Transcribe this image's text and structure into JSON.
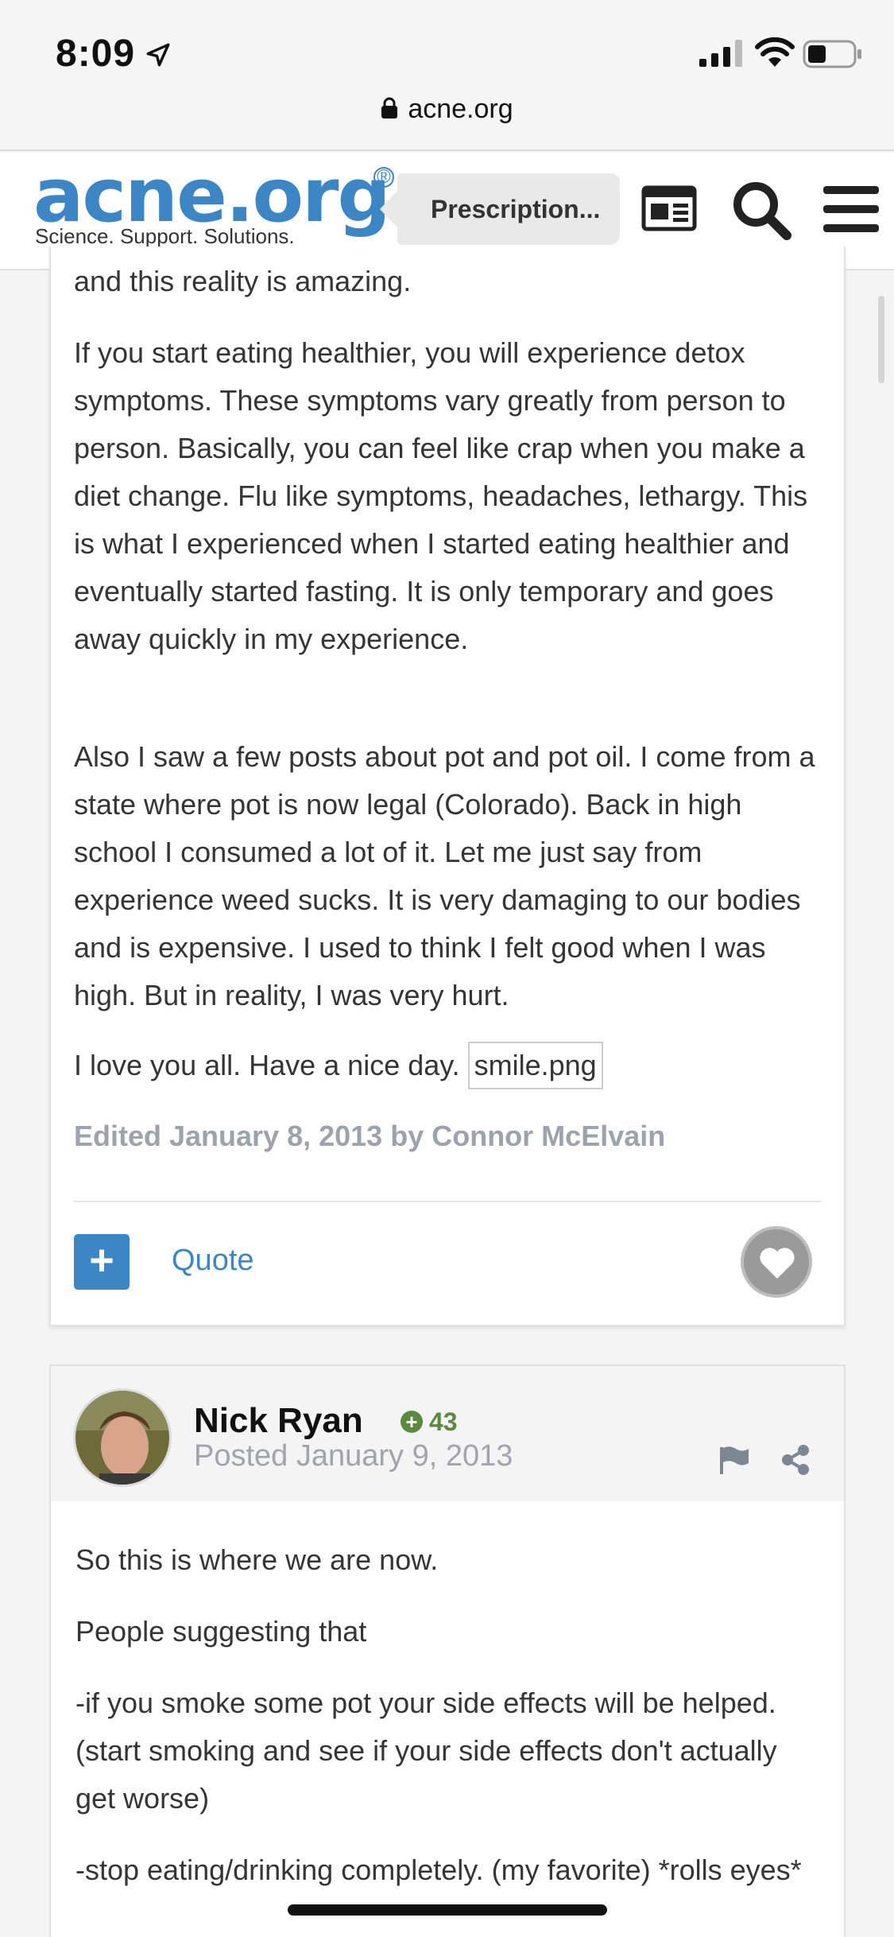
{
  "status_bar": {
    "time": "8:09",
    "url": "acne.org"
  },
  "header": {
    "logo_text": "acne.org",
    "logo_reg": "®",
    "tagline": "Science. Support. Solutions.",
    "breadcrumb": "Prescription...",
    "brand_color": "#3d86c6",
    "icons": [
      "newspaper-icon",
      "search-icon",
      "menu-icon"
    ]
  },
  "post1": {
    "paragraphs": [
      "and this reality is amazing.",
      "If you start eating healthier, you will experience detox symptoms. These symptoms vary greatly from person to person. Basically, you can feel like crap when you make a diet change. Flu like symptoms, headaches, lethargy. This is what I experienced when I started eating healthier and eventually started fasting. It is only temporary and goes away quickly in my experience.",
      "Also I saw a few posts about pot and pot oil. I come from a state where pot is now legal (Colorado). Back in high school I consumed a lot of it. Let me just say from experience weed sucks. It is very damaging to our bodies and is expensive. I used to think I felt good when I was high. But in reality, I was very hurt.",
      "I love you all. Have a nice day."
    ],
    "image_placeholder": "smile.png",
    "edited": "Edited January 8, 2013 by Connor McElvain",
    "quote_label": "Quote",
    "plus_label": "+"
  },
  "post2": {
    "author": "Nick Ryan",
    "reputation": "43",
    "posted": "Posted January 9, 2013",
    "paragraphs": [
      "So this is where we are now.",
      "People suggesting that",
      "-if you smoke some pot your side effects will be helped. (start smoking and see if your side effects don't actually get worse)",
      "-stop eating/drinking completely. (my favorite) *rolls eyes*"
    ],
    "reputation_color": "#5a8a3f"
  }
}
